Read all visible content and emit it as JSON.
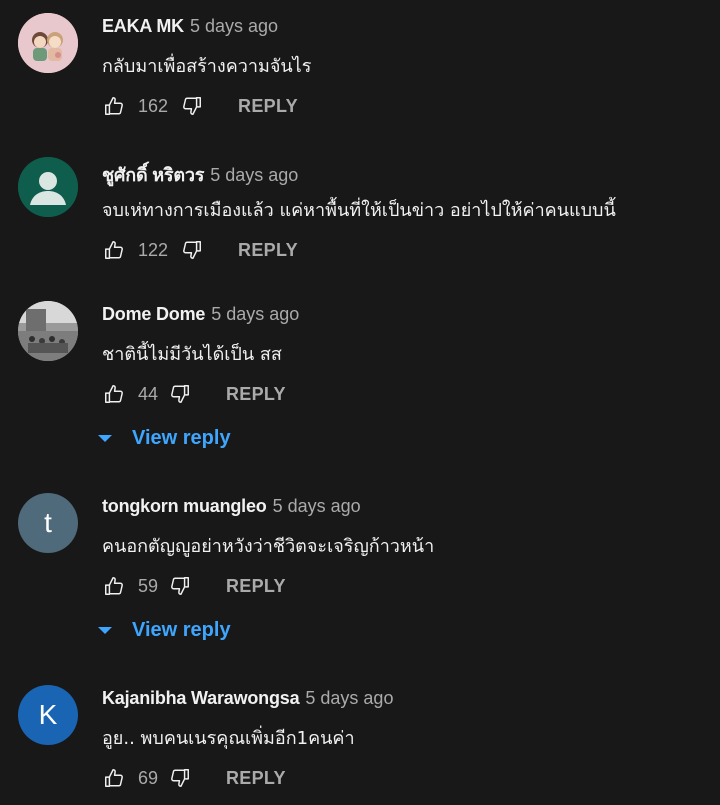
{
  "comments": [
    {
      "author": "EAKA MK",
      "time": "5 days ago",
      "text": "กลับมาเพื่อสร้างความจันไร",
      "likes": "162",
      "reply_label": "REPLY",
      "avatar": {
        "type": "image",
        "icon": "couple-illustration-icon",
        "bg": "#e9c8cd"
      }
    },
    {
      "author": "ชูศักดิ์ หริตวร",
      "time": "5 days ago",
      "text": "จบเห่ทางการเมืองแล้ว  แค่หาพื้นที่ให้เป็นข่าว อย่าไปให้ค่าคนแบบนี้",
      "likes": "122",
      "reply_label": "REPLY",
      "avatar": {
        "type": "default",
        "icon": "default-user-icon",
        "bg": "#0f5d4c"
      }
    },
    {
      "author": "Dome Dome",
      "time": "5 days ago",
      "text": "ชาตินี้ไม่มีวันได้เป็น สส",
      "likes": "44",
      "reply_label": "REPLY",
      "view_reply_label": "View reply",
      "avatar": {
        "type": "photo",
        "icon": "group-photo-icon",
        "bg": "#888888"
      }
    },
    {
      "author": "tongkorn muangleo",
      "time": "5 days ago",
      "text": "คนอกตัญญูอย่าหวังว่าชีวิตจะเจริญก้าวหน้า",
      "likes": "59",
      "reply_label": "REPLY",
      "view_reply_label": "View reply",
      "avatar": {
        "type": "letter",
        "letter": "t",
        "bg": "#4f6a7a"
      }
    },
    {
      "author": "Kajanibha Warawongsa",
      "time": "5 days ago",
      "text": "อูย.. พบคนเนรคุณเพิ่มอีก1คนค่า",
      "likes": "69",
      "reply_label": "REPLY",
      "avatar": {
        "type": "letter",
        "letter": "K",
        "bg": "#1a64b4"
      }
    }
  ],
  "colors": {
    "background": "#181818",
    "primary_text": "#f1f1f1",
    "secondary_text": "#aaaaaa",
    "link_blue": "#3ea6ff"
  }
}
